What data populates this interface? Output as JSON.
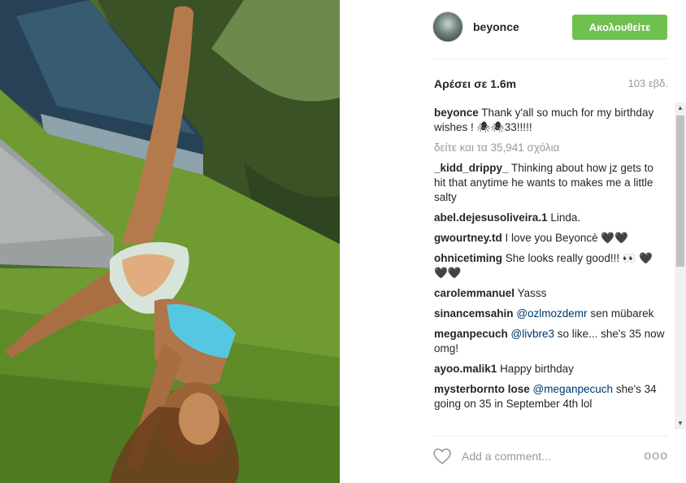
{
  "header": {
    "username": "beyonce",
    "follow_label": "Ακολουθείτε"
  },
  "stats": {
    "likes": "Αρέσει σε 1.6m",
    "age": "103 εβδ."
  },
  "caption": {
    "user": "beyonce",
    "text": "Thank y'all so much for my birthday wishes ! 🕷🕷33!!!!!"
  },
  "view_all": "δείτε και τα 35,941 σχόλια",
  "comments": [
    {
      "user": "_kidd_drippy_",
      "text": "Thinking about how jz gets to hit that anytime he wants to makes me a little salty"
    },
    {
      "user": "abel.dejesusoliveira.1",
      "text": "Linda."
    },
    {
      "user": "gwourtney.td",
      "text": "I love you Beyoncè 🖤🖤"
    },
    {
      "user": "ohnicetiming",
      "text": "She looks really good!!! 👀 🖤🖤🖤"
    },
    {
      "user": "carolemmanuel",
      "text": "Yasss"
    },
    {
      "user": "sinancemsahin",
      "mention": "@ozlmozdemr",
      "text": "sen mübarek"
    },
    {
      "user": "meganpecuch",
      "mention": "@livbre3",
      "text": "so like... she's 35 now omg!"
    },
    {
      "user": "ayoo.malik1",
      "text": "Happy birthday"
    },
    {
      "user": "mysterbornto lose",
      "mention": "@meganpecuch",
      "text": "she's 34 going on 35 in September 4th lol"
    }
  ],
  "footer": {
    "add_comment_placeholder": "Add a comment...",
    "more_label": "ooo"
  },
  "icons": {
    "heart": "heart-icon",
    "more": "more-options-icon"
  },
  "colors": {
    "follow_button": "#70c050",
    "mention": "#003569"
  }
}
